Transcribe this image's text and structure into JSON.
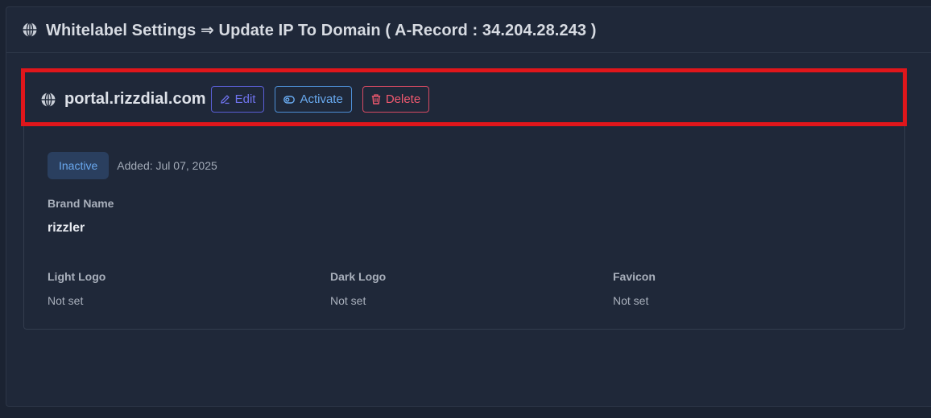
{
  "header": {
    "icon": "globe-icon",
    "title": "Whitelabel Settings ⇒ Update IP To Domain ( A-Record : 34.204.28.243 )"
  },
  "domain": {
    "icon": "globe-icon",
    "name": "portal.rizzdial.com",
    "actions": {
      "edit_label": "Edit",
      "activate_label": "Activate",
      "delete_label": "Delete"
    },
    "status": "Inactive",
    "added": "Added: Jul 07, 2025",
    "brand_name_label": "Brand Name",
    "brand_name_value": "rizzler",
    "logos": [
      {
        "label": "Light Logo",
        "value": "Not set"
      },
      {
        "label": "Dark Logo",
        "value": "Not set"
      },
      {
        "label": "Favicon",
        "value": "Not set"
      }
    ]
  },
  "colors": {
    "background": "#1b2332",
    "panel": "#1f2839",
    "edit": "#6f73ee",
    "activate": "#69aaf0",
    "delete": "#f0596f",
    "highlight": "#e0161b",
    "badge_bg": "#2a3f5f"
  }
}
